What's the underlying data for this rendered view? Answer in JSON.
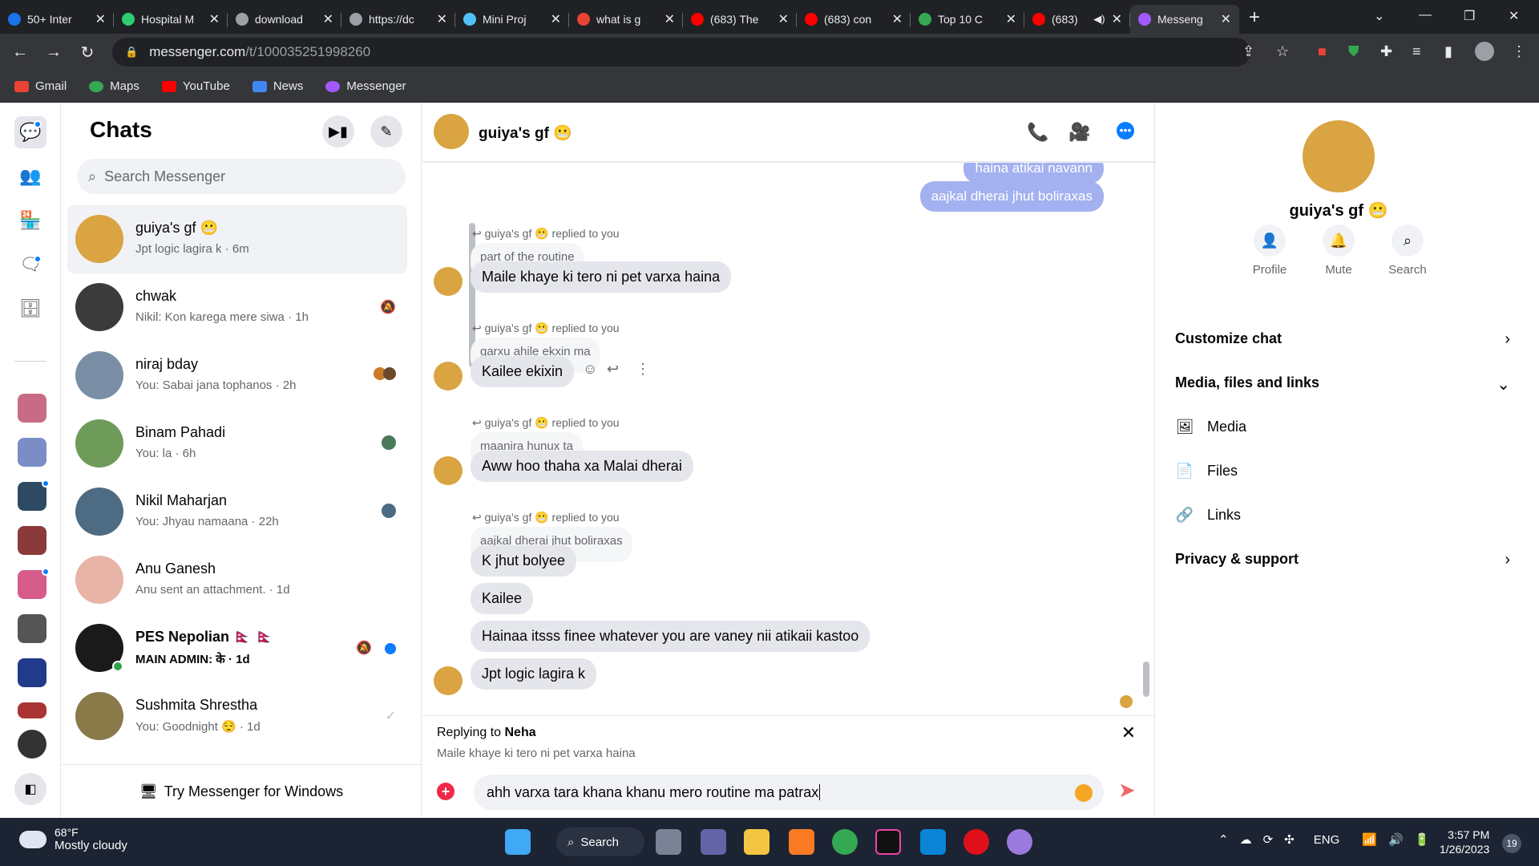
{
  "browser": {
    "tabs": [
      {
        "title": "50+ Inter",
        "color": "#1a73e8"
      },
      {
        "title": "Hospital M",
        "color": "#2ecc71"
      },
      {
        "title": "download",
        "color": "#9aa0a6"
      },
      {
        "title": "https://dc",
        "color": "#9aa0a6"
      },
      {
        "title": "Mini Proj",
        "color": "#4fc3f7"
      },
      {
        "title": "what is g",
        "color": "#ea4335"
      },
      {
        "title": "(683) The",
        "color": "#ff0000"
      },
      {
        "title": "(683) con",
        "color": "#ff0000"
      },
      {
        "title": "Top 10 C",
        "color": "#34a853"
      },
      {
        "title": "(683)",
        "color": "#ff0000"
      },
      {
        "title": "Messeng",
        "color": "#a259ff"
      }
    ],
    "new_tab": "+",
    "close_glyph": "✕",
    "url_host": "messenger.com",
    "url_path": "/t/100035251998260",
    "bookmarks": [
      {
        "label": "Gmail",
        "color": "#ea4335"
      },
      {
        "label": "Maps",
        "color": "#34a853"
      },
      {
        "label": "YouTube",
        "color": "#ff0000"
      },
      {
        "label": "News",
        "color": "#4285f4"
      },
      {
        "label": "Messenger",
        "color": "#a259ff"
      }
    ]
  },
  "sidebar": {
    "title": "Chats",
    "search_placeholder": "Search Messenger",
    "try_windows": "Try Messenger for Windows",
    "chats": [
      {
        "name": "guiya's gf 😬",
        "preview": "Jpt logic lagira k · 6m",
        "avatar": "#d9a441",
        "unread": false,
        "right": ""
      },
      {
        "name": "chwak",
        "preview": "Nikil: Kon karega mere siwa · 1h",
        "avatar": "#3b3b3b",
        "unread": false,
        "right": "🔕"
      },
      {
        "name": "niraj bday",
        "preview": "You: Sabai jana tophanos · 2h",
        "avatar": "#7a8fa6",
        "unread": false,
        "right": "●●"
      },
      {
        "name": "Binam Pahadi",
        "preview": "You: la · 6h",
        "avatar": "#6e9a5a",
        "unread": false,
        "right": "●"
      },
      {
        "name": "Nikil Maharjan",
        "preview": "You: Jhyau namaana · 22h",
        "avatar": "#4d6b82",
        "unread": false,
        "right": "●"
      },
      {
        "name": "Anu Ganesh",
        "preview": "Anu sent an attachment. · 1d",
        "avatar": "#e8b4a8",
        "unread": false,
        "right": ""
      },
      {
        "name": "PES Nepolian 🇳🇵 🇳🇵",
        "preview": "MAIN ADMIN: के · 1d",
        "avatar": "#1a1a1a",
        "unread": true,
        "right": "🔕 ●"
      },
      {
        "name": "Sushmita Shrestha",
        "preview": "You: Goodnight 😌 · 1d",
        "avatar": "#8a7a4a",
        "unread": false,
        "right": "✓"
      }
    ]
  },
  "conversation": {
    "name": "guiya's gf 😬",
    "partial_top": "haina atikai navann",
    "my_message": "aajkal dherai jhut boliraxas",
    "replied_label": "guiya's gf 😬 replied to you",
    "thread": [
      {
        "quote": "part of the routine",
        "reply": "Maile khaye ki tero ni pet varxa haina"
      },
      {
        "quote": "garxu ahile ekxin ma",
        "reply": "Kailee ekixin"
      },
      {
        "quote": "maanira hunux ta",
        "reply": "Aww hoo thaha xa Malai dherai"
      },
      {
        "quote": "aajkal dherai jhut boliraxas",
        "reply": "K jhut bolyee"
      }
    ],
    "followups": [
      "Kailee",
      "Hainaa itsss finee whatever you are vaney nii atikaii kastoo",
      "Jpt logic lagira k"
    ],
    "replying_prefix": "Replying to",
    "replying_name": "Neha",
    "replying_text": "Maile khaye ki tero ni pet varxa haina",
    "composer_text": "ahh varxa tara khana khanu mero routine ma patrax"
  },
  "info": {
    "name": "guiya's gf 😬",
    "buttons": [
      "Profile",
      "Mute",
      "Search"
    ],
    "customize": "Customize chat",
    "media_section": "Media, files and links",
    "media": "Media",
    "files": "Files",
    "links": "Links",
    "privacy": "Privacy & support"
  },
  "taskbar": {
    "temp": "68°F",
    "weather": "Mostly cloudy",
    "search": "Search",
    "lang": "ENG",
    "time": "3:57 PM",
    "date": "1/26/2023",
    "notifications": "19"
  },
  "colors": {
    "accent": "#0a7cff",
    "my_bubble": "#a3b1f0",
    "their_bubble": "#e4e6eb"
  }
}
